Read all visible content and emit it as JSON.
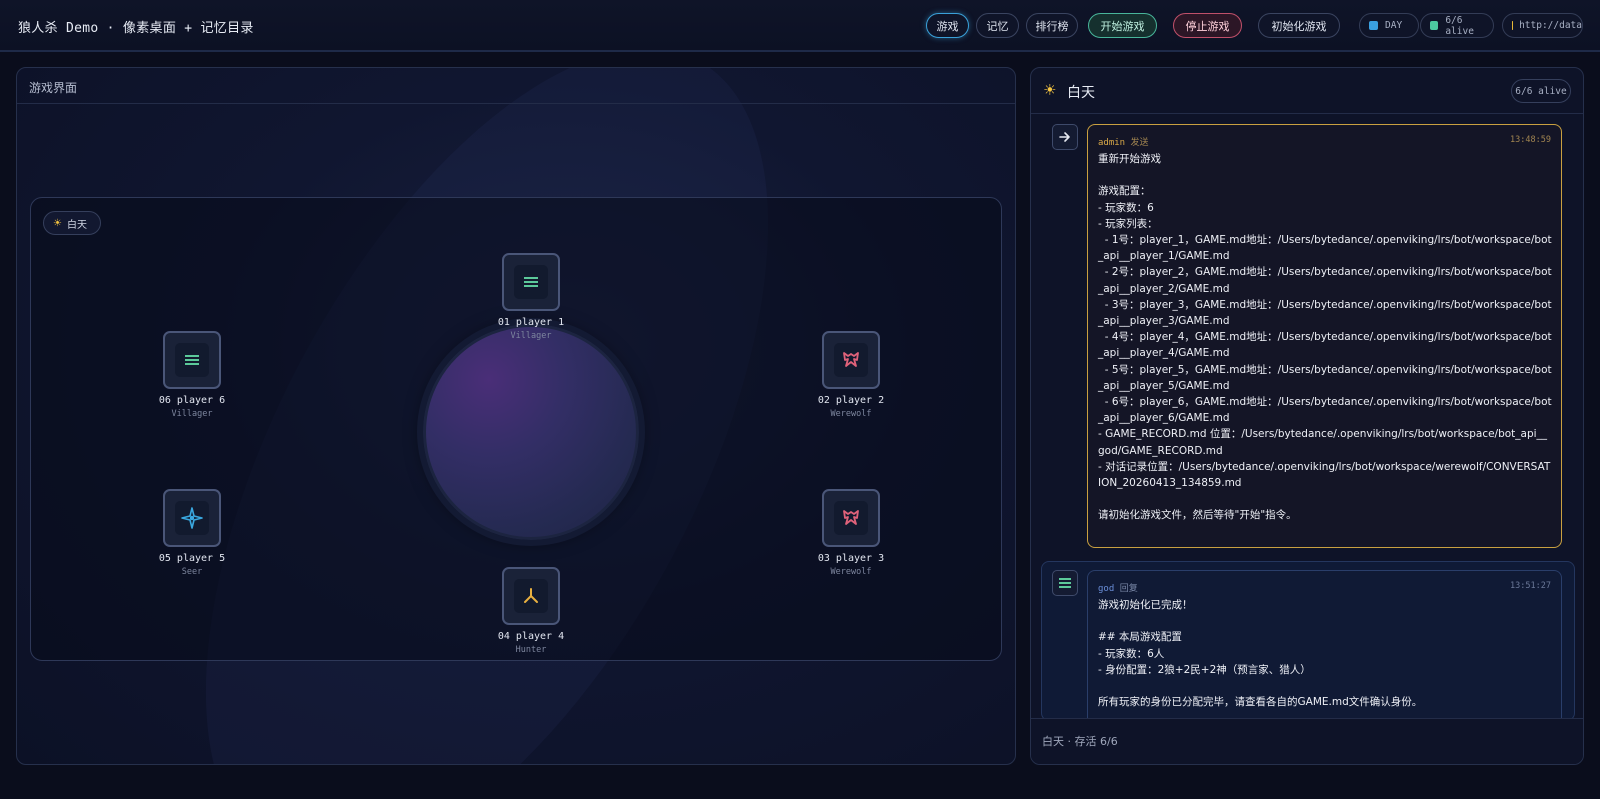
{
  "app": {
    "title": "狼人杀 Demo · 像素桌面 + 记忆目录"
  },
  "nav": {
    "game": "游戏",
    "memory": "记忆",
    "leaderboard": "排行榜",
    "start": "开始游戏",
    "stop": "停止游戏",
    "init": "初始化游戏"
  },
  "status": {
    "phase": "DAY",
    "alive": "6/6 alive",
    "url": "http://data"
  },
  "colors": {
    "phase_dot": "#3aa0e0",
    "alive_dot": "#4cc9a0",
    "url_dot": "#e8b838",
    "villager": "#5cc99a",
    "werewolf": "#e0627a",
    "seer": "#3aa8e0",
    "hunter": "#e8b040"
  },
  "game_panel": {
    "title": "游戏界面",
    "phase_chip": "白天",
    "players": [
      {
        "name": "01 player 1",
        "role": "Villager",
        "icon": "villager-lines-icon"
      },
      {
        "name": "02 player 2",
        "role": "Werewolf",
        "icon": "werewolf-mask-icon"
      },
      {
        "name": "03 player 3",
        "role": "Werewolf",
        "icon": "werewolf-mask-icon"
      },
      {
        "name": "04 player 4",
        "role": "Hunter",
        "icon": "hunter-arrow-icon"
      },
      {
        "name": "05 player 5",
        "role": "Seer",
        "icon": "seer-star-icon"
      },
      {
        "name": "06 player 6",
        "role": "Villager",
        "icon": "villager-lines-icon"
      }
    ]
  },
  "chat_panel": {
    "title": "白天",
    "alive": "6/6 alive",
    "messages": [
      {
        "sender": "admin",
        "action": "发送",
        "time": "13:48:59",
        "icon": "arrow-right-icon",
        "body": "重新开始游戏\n\n游戏配置：\n- 玩家数：6\n- 玩家列表：\n  - 1号：player_1，GAME.md地址：/Users/bytedance/.openviking/lrs/bot/workspace/bot_api__player_1/GAME.md\n  - 2号：player_2，GAME.md地址：/Users/bytedance/.openviking/lrs/bot/workspace/bot_api__player_2/GAME.md\n  - 3号：player_3，GAME.md地址：/Users/bytedance/.openviking/lrs/bot/workspace/bot_api__player_3/GAME.md\n  - 4号：player_4，GAME.md地址：/Users/bytedance/.openviking/lrs/bot/workspace/bot_api__player_4/GAME.md\n  - 5号：player_5，GAME.md地址：/Users/bytedance/.openviking/lrs/bot/workspace/bot_api__player_5/GAME.md\n  - 6号：player_6，GAME.md地址：/Users/bytedance/.openviking/lrs/bot/workspace/bot_api__player_6/GAME.md\n- GAME_RECORD.md 位置：/Users/bytedance/.openviking/lrs/bot/workspace/bot_api__god/GAME_RECORD.md\n- 对话记录位置：/Users/bytedance/.openviking/lrs/bot/workspace/werewolf/CONVERSATION_20260413_134859.md\n\n请初始化游戏文件，然后等待\"开始\"指令。"
      },
      {
        "sender": "god",
        "action": "回复",
        "time": "13:51:27",
        "icon": "god-lines-icon",
        "body": "游戏初始化已完成！\n\n## 本局游戏配置\n- 玩家数：6人\n- 身份配置：2狼+2民+2神（预言家、猎人）\n\n所有玩家的身份已分配完毕，请查看各自的GAME.md文件确认身份。"
      }
    ],
    "footer": "白天 · 存活 6/6"
  }
}
